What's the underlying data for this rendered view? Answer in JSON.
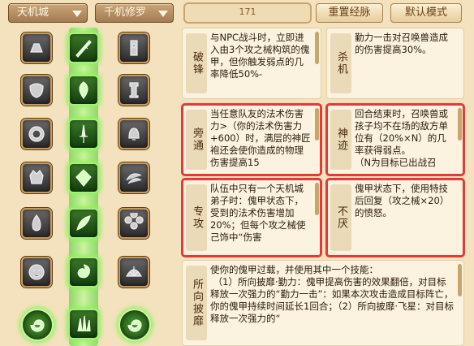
{
  "topbar": {
    "sect_dropdown": "天机城",
    "path_dropdown": "千机修罗",
    "points": "171",
    "reset_button": "重置经脉",
    "default_button": "默认模式"
  },
  "skills": [
    {
      "title": "破锋",
      "text": "与NPC战斗时，立即进入由3个攻之械构筑的傀甲，但你触发弱点的几率降低50%-",
      "highlight": false
    },
    {
      "title": "杀机",
      "text": "勤力一击对召唤兽造成的伤害提高30%。",
      "highlight": false
    },
    {
      "title": "旁通",
      "text": "当任意队友的法术伤害力>（你的法术伤害力+600）时，满层的神匠袍还会使你造成的物理伤害提高15",
      "highlight": true
    },
    {
      "title": "神迹",
      "text": "回合结束时，召唤兽或孩子均不在场的敌方单位有（20%×N）的几率获得弱点。\n（N为目标已出战召",
      "highlight": true
    },
    {
      "title": "专攻",
      "text": "队伍中只有一个天机城弟子时：傀甲状态下，受到的法术伤害增加20%；但每个攻之械使己饰中“伤害",
      "highlight": true
    },
    {
      "title": "不厌",
      "text": "傀甲状态下，使用特技后回复（攻之械×20）的愤怒。",
      "highlight": true
    },
    {
      "title": "所向披靡",
      "text": "使你的傀甲过载，并使用其中一个技能：\n （1）所向披靡·勤力：傀甲提高伤害的效果翻倍，对目标释放一次强力的“勤力一击”：如果本次攻击造成目标阵亡，你的傀甲持续时间延长1回合；（2）所向披靡·飞星：对目标释放一次强力的“",
      "highlight": false
    }
  ],
  "nodes": [
    {
      "name": "node-r1-left",
      "icon": "fist-icon",
      "active": false
    },
    {
      "name": "node-r1-mid",
      "icon": "blade-icon",
      "active": true
    },
    {
      "name": "node-r1-right",
      "icon": "tower-icon",
      "active": false
    },
    {
      "name": "node-r2-left",
      "icon": "mask-icon",
      "active": false
    },
    {
      "name": "node-r2-mid",
      "icon": "leaf-icon",
      "active": true
    },
    {
      "name": "node-r2-right",
      "icon": "pillar-icon",
      "active": false
    },
    {
      "name": "node-r3-left",
      "icon": "ring-icon",
      "active": false
    },
    {
      "name": "node-r3-mid",
      "icon": "sword-icon",
      "active": true
    },
    {
      "name": "node-r3-right",
      "icon": "bell-icon",
      "active": false
    },
    {
      "name": "node-r4-left",
      "icon": "beast-icon",
      "active": false
    },
    {
      "name": "node-r4-mid",
      "icon": "gem-icon",
      "active": true
    },
    {
      "name": "node-r4-right",
      "icon": "swirl-icon",
      "active": false
    },
    {
      "name": "node-r5-left",
      "icon": "fire-icon",
      "active": false
    },
    {
      "name": "node-r5-mid",
      "icon": "feather-icon",
      "active": true
    },
    {
      "name": "node-r5-right",
      "icon": "flower-icon",
      "active": false
    },
    {
      "name": "node-r6-left",
      "icon": "face-icon",
      "active": false
    },
    {
      "name": "node-r6-mid",
      "icon": "vortex-icon",
      "active": true
    },
    {
      "name": "node-r6-right",
      "icon": "shell-icon",
      "active": false
    },
    {
      "name": "node-r7-left",
      "icon": "spiral-icon",
      "active": true
    },
    {
      "name": "node-r7-mid",
      "icon": "spike-icon",
      "active": true
    },
    {
      "name": "node-r7-right",
      "icon": "spiral-icon",
      "active": true
    }
  ],
  "colors": {
    "highlight": "#e03a3a",
    "active_glow": "#8ef25a"
  }
}
